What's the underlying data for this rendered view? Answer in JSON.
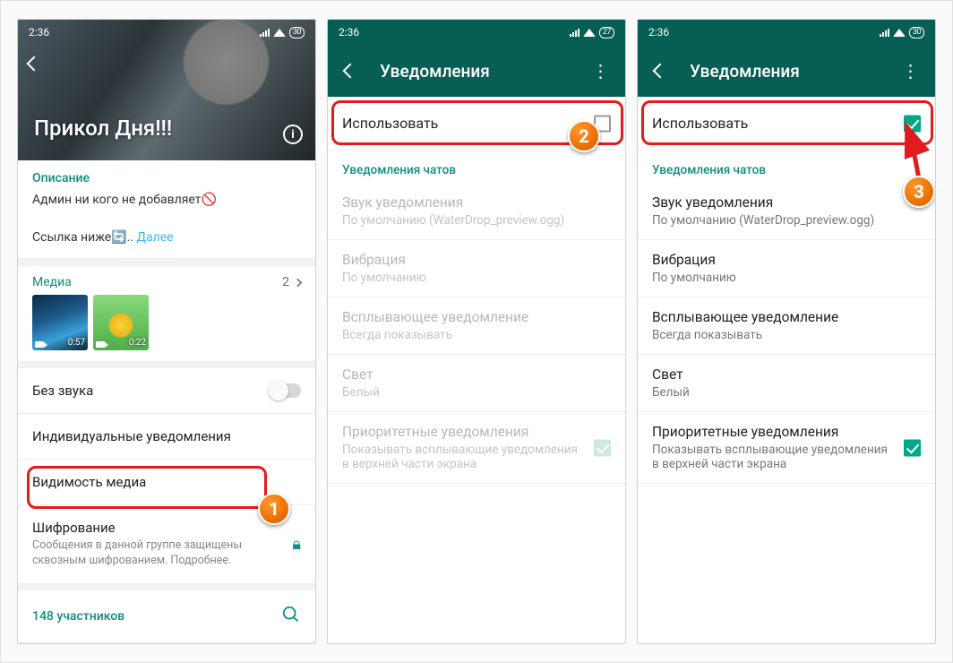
{
  "status": {
    "time": "2:36",
    "battery1": "30",
    "battery2": "27",
    "battery3": "30"
  },
  "screen1": {
    "group_title": "Прикол Дня!!!",
    "desc_label": "Описание",
    "desc_line1": "Админ ни кого не добавляет🚫",
    "desc_line2_prefix": "Ссылка ниже🔄.. ",
    "desc_more": "Далее",
    "media_label": "Медиа",
    "media_count": "2",
    "thumb1_dur": "0:57",
    "thumb2_dur": "0:22",
    "mute_label": "Без звука",
    "custom_notif": "Индивидуальные уведомления",
    "media_vis": "Видимость медиа",
    "encryption_title": "Шифрование",
    "encryption_sub": "Сообщения в данной группе защищены сквозным шифрованием. Подробнее.",
    "members": "148 участников"
  },
  "notif": {
    "header": "Уведомления",
    "use": "Использовать",
    "section": "Уведомления чатов",
    "sound_t": "Звук уведомления",
    "sound_s": "По умолчанию (WaterDrop_preview.ogg)",
    "vibr_t": "Вибрация",
    "vibr_s": "По умолчанию",
    "popup_t": "Всплывающее уведомление",
    "popup_s": "Всегда показывать",
    "light_t": "Свет",
    "light_s": "Белый",
    "prio_t": "Приоритетные уведомления",
    "prio_s": "Показывать всплывающие уведомления в верхней части экрана"
  },
  "annotations": {
    "b1": "1",
    "b2": "2",
    "b3": "3"
  }
}
